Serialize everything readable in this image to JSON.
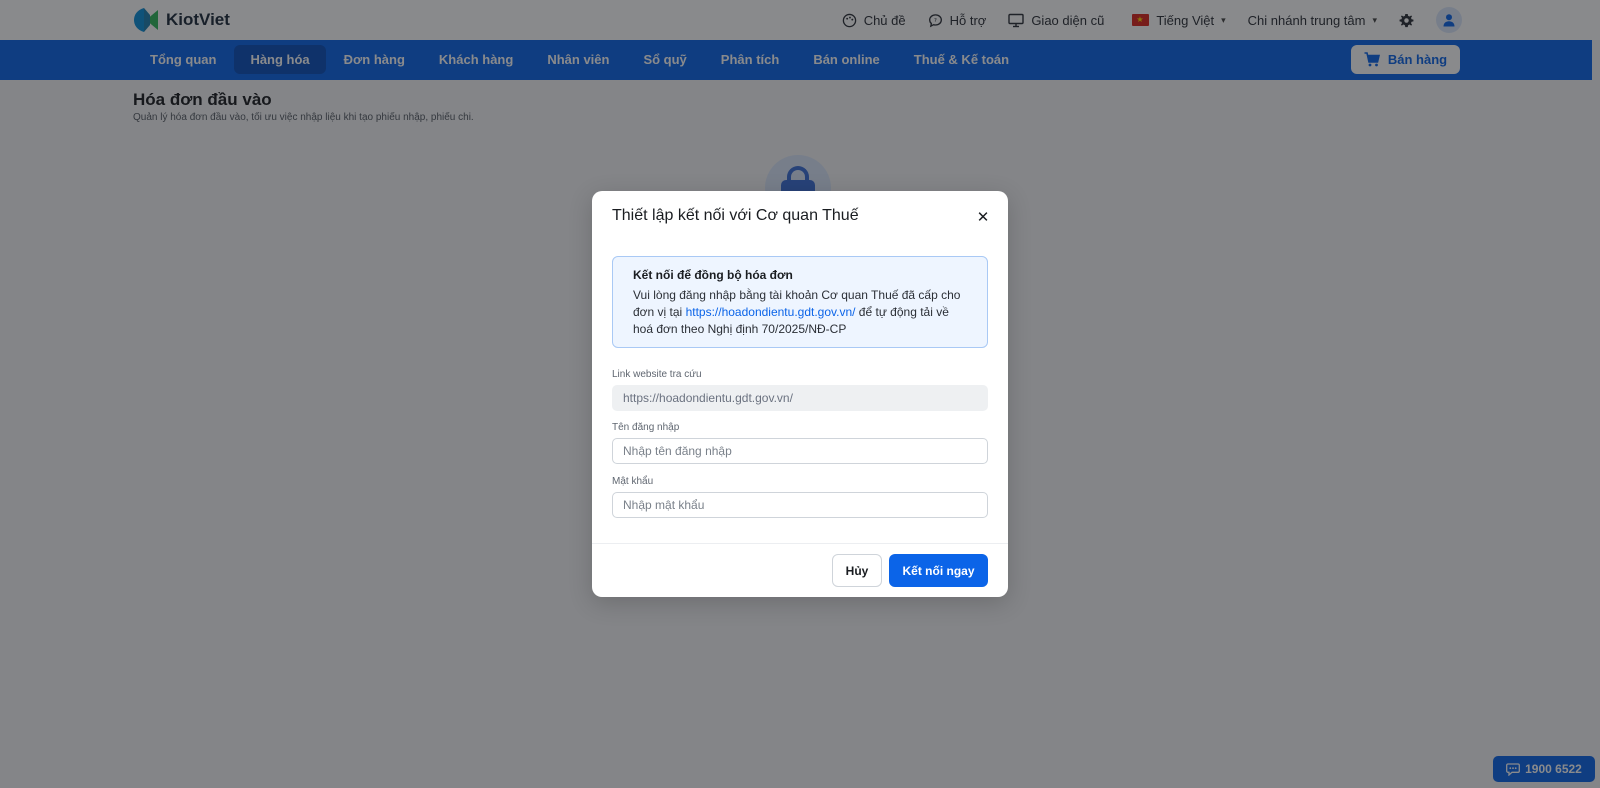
{
  "brand": {
    "name": "KiotViet"
  },
  "topbar": {
    "theme_label": "Chủ đề",
    "support_label": "Hỗ trợ",
    "classic_ui_label": "Giao diện cũ",
    "language_label": "Tiếng Việt",
    "branch_label": "Chi nhánh trung tâm"
  },
  "nav": {
    "items": [
      "Tổng quan",
      "Hàng hóa",
      "Đơn hàng",
      "Khách hàng",
      "Nhân viên",
      "Sổ quỹ",
      "Phân tích",
      "Bán online",
      "Thuế & Kế toán"
    ],
    "active": "Hàng hóa",
    "sell_label": "Bán hàng"
  },
  "page": {
    "title": "Hóa đơn đầu vào",
    "subtitle": "Quản lý hóa đơn đầu vào, tối ưu việc nhập liệu khi tạo phiếu nhập, phiếu chi."
  },
  "modal": {
    "title": "Thiết lập kết nối với Cơ quan Thuế",
    "info_title": "Kết nối để đồng bộ hóa đơn",
    "info_text_before": "Vui lòng đăng nhập bằng tài khoản Cơ quan Thuế đã cấp cho đơn vị tại ",
    "info_link": "https://hoadondientu.gdt.gov.vn/",
    "info_text_after": " để tự động tải về hoá đơn theo Nghị định 70/2025/NĐ-CP",
    "website_label": "Link website tra cứu",
    "website_value": "https://hoadondientu.gdt.gov.vn/",
    "username_label": "Tên đăng nhập",
    "username_placeholder": "Nhập tên đăng nhập",
    "password_label": "Mật khẩu",
    "password_placeholder": "Nhập mật khẩu",
    "cancel_label": "Hủy",
    "connect_label": "Kết nối ngay"
  },
  "hotline": {
    "number": "1900 6522"
  },
  "colors": {
    "primary": "#0b64e8",
    "nav_active": "#0a4fba",
    "info_bg": "#eef5ff"
  }
}
